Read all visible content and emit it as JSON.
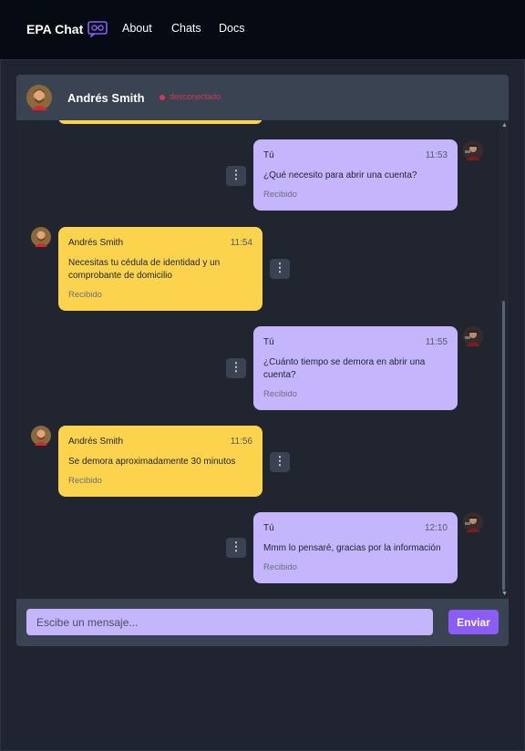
{
  "nav": {
    "brand": "EPA Chat",
    "links": [
      "About",
      "Chats",
      "Docs"
    ]
  },
  "header": {
    "name": "Andrés Smith",
    "status": "desconectado"
  },
  "messages": [
    {
      "sender": "Tú",
      "time": "11:53",
      "text": "¿Qué necesito para abrir una cuenta?",
      "status": "Recibido",
      "mine": true
    },
    {
      "sender": "Andrés Smith",
      "time": "11:54",
      "text": "Necesitas tu cédula de identidad y un comprobante de domicilio",
      "status": "Recibido",
      "mine": false
    },
    {
      "sender": "Tú",
      "time": "11:55",
      "text": "¿Cuánto tiempo se demora en abrir una cuenta?",
      "status": "Recibido",
      "mine": true
    },
    {
      "sender": "Andrés Smith",
      "time": "11:56",
      "text": "Se demora aproximadamente 30 minutos",
      "status": "Recibido",
      "mine": false
    },
    {
      "sender": "Tú",
      "time": "12:10",
      "text": "Mmm lo pensaré, gracias por la información",
      "status": "Recibido",
      "mine": true
    }
  ],
  "composer": {
    "placeholder": "Escibe un mensaje...",
    "send_label": "Enviar"
  },
  "colors": {
    "accent": "#8b5cf6",
    "mine_bubble": "#c4b5fd",
    "their_bubble": "#fcd34d",
    "offline": "#d9374b"
  }
}
